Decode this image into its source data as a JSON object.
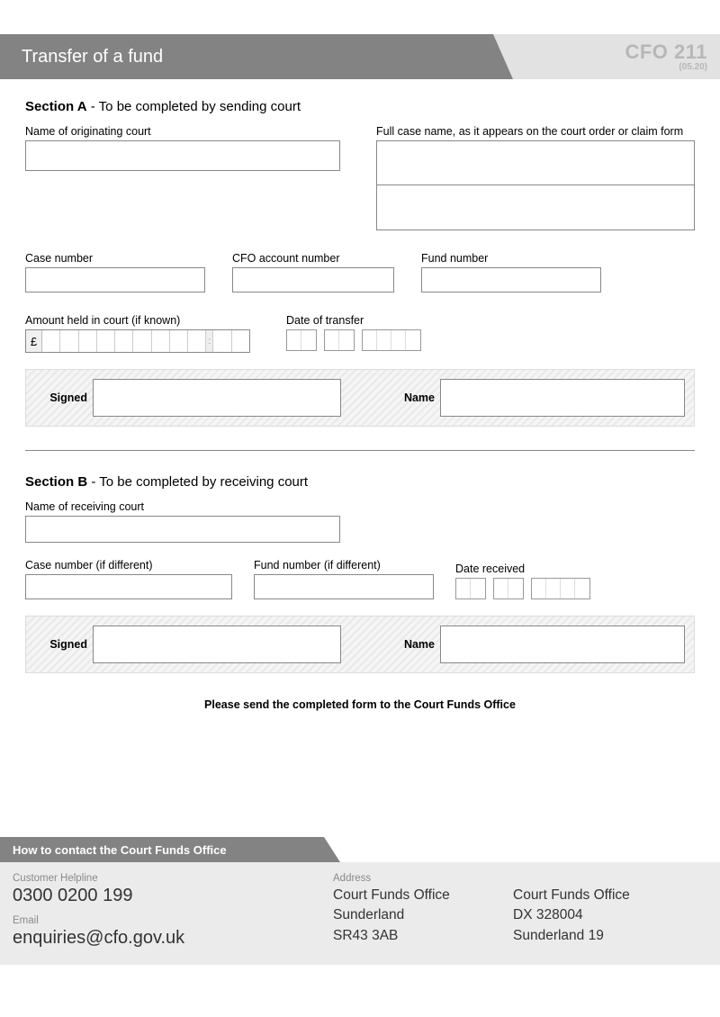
{
  "header": {
    "title": "Transfer of a fund",
    "formCode": "CFO 211",
    "version": "(05.20)"
  },
  "sectionA": {
    "title_bold": "Section A",
    "title_rest": " - To be completed by sending court",
    "labels": {
      "originatingCourt": "Name of originating court",
      "fullCaseName": "Full case name, as it appears on the court order or claim form",
      "caseNumber": "Case number",
      "cfoAccount": "CFO account number",
      "fundNumber": "Fund number",
      "amountHeld": "Amount held in court (if known)",
      "dateTransfer": "Date of transfer",
      "signed": "Signed",
      "name": "Name",
      "currency": "£"
    }
  },
  "sectionB": {
    "title_bold": "Section B",
    "title_rest": " - To be completed by receiving court",
    "labels": {
      "receivingCourt": "Name of receiving court",
      "caseNumber": "Case number (if different)",
      "fundNumber": "Fund number (if different)",
      "dateReceived": "Date received",
      "signed": "Signed",
      "name": "Name"
    }
  },
  "instruction": "Please send the completed form to the Court Funds Office",
  "footer": {
    "heading": "How to contact the Court Funds Office",
    "helplineLabel": "Customer Helpline",
    "helpline": "0300 0200 199",
    "emailLabel": "Email",
    "email": "enquiries@cfo.gov.uk",
    "addressLabel": "Address",
    "addr1": [
      "Court Funds Office",
      "Sunderland",
      "SR43 3AB"
    ],
    "addr2": [
      "Court Funds Office",
      "DX 328004",
      "Sunderland 19"
    ]
  }
}
